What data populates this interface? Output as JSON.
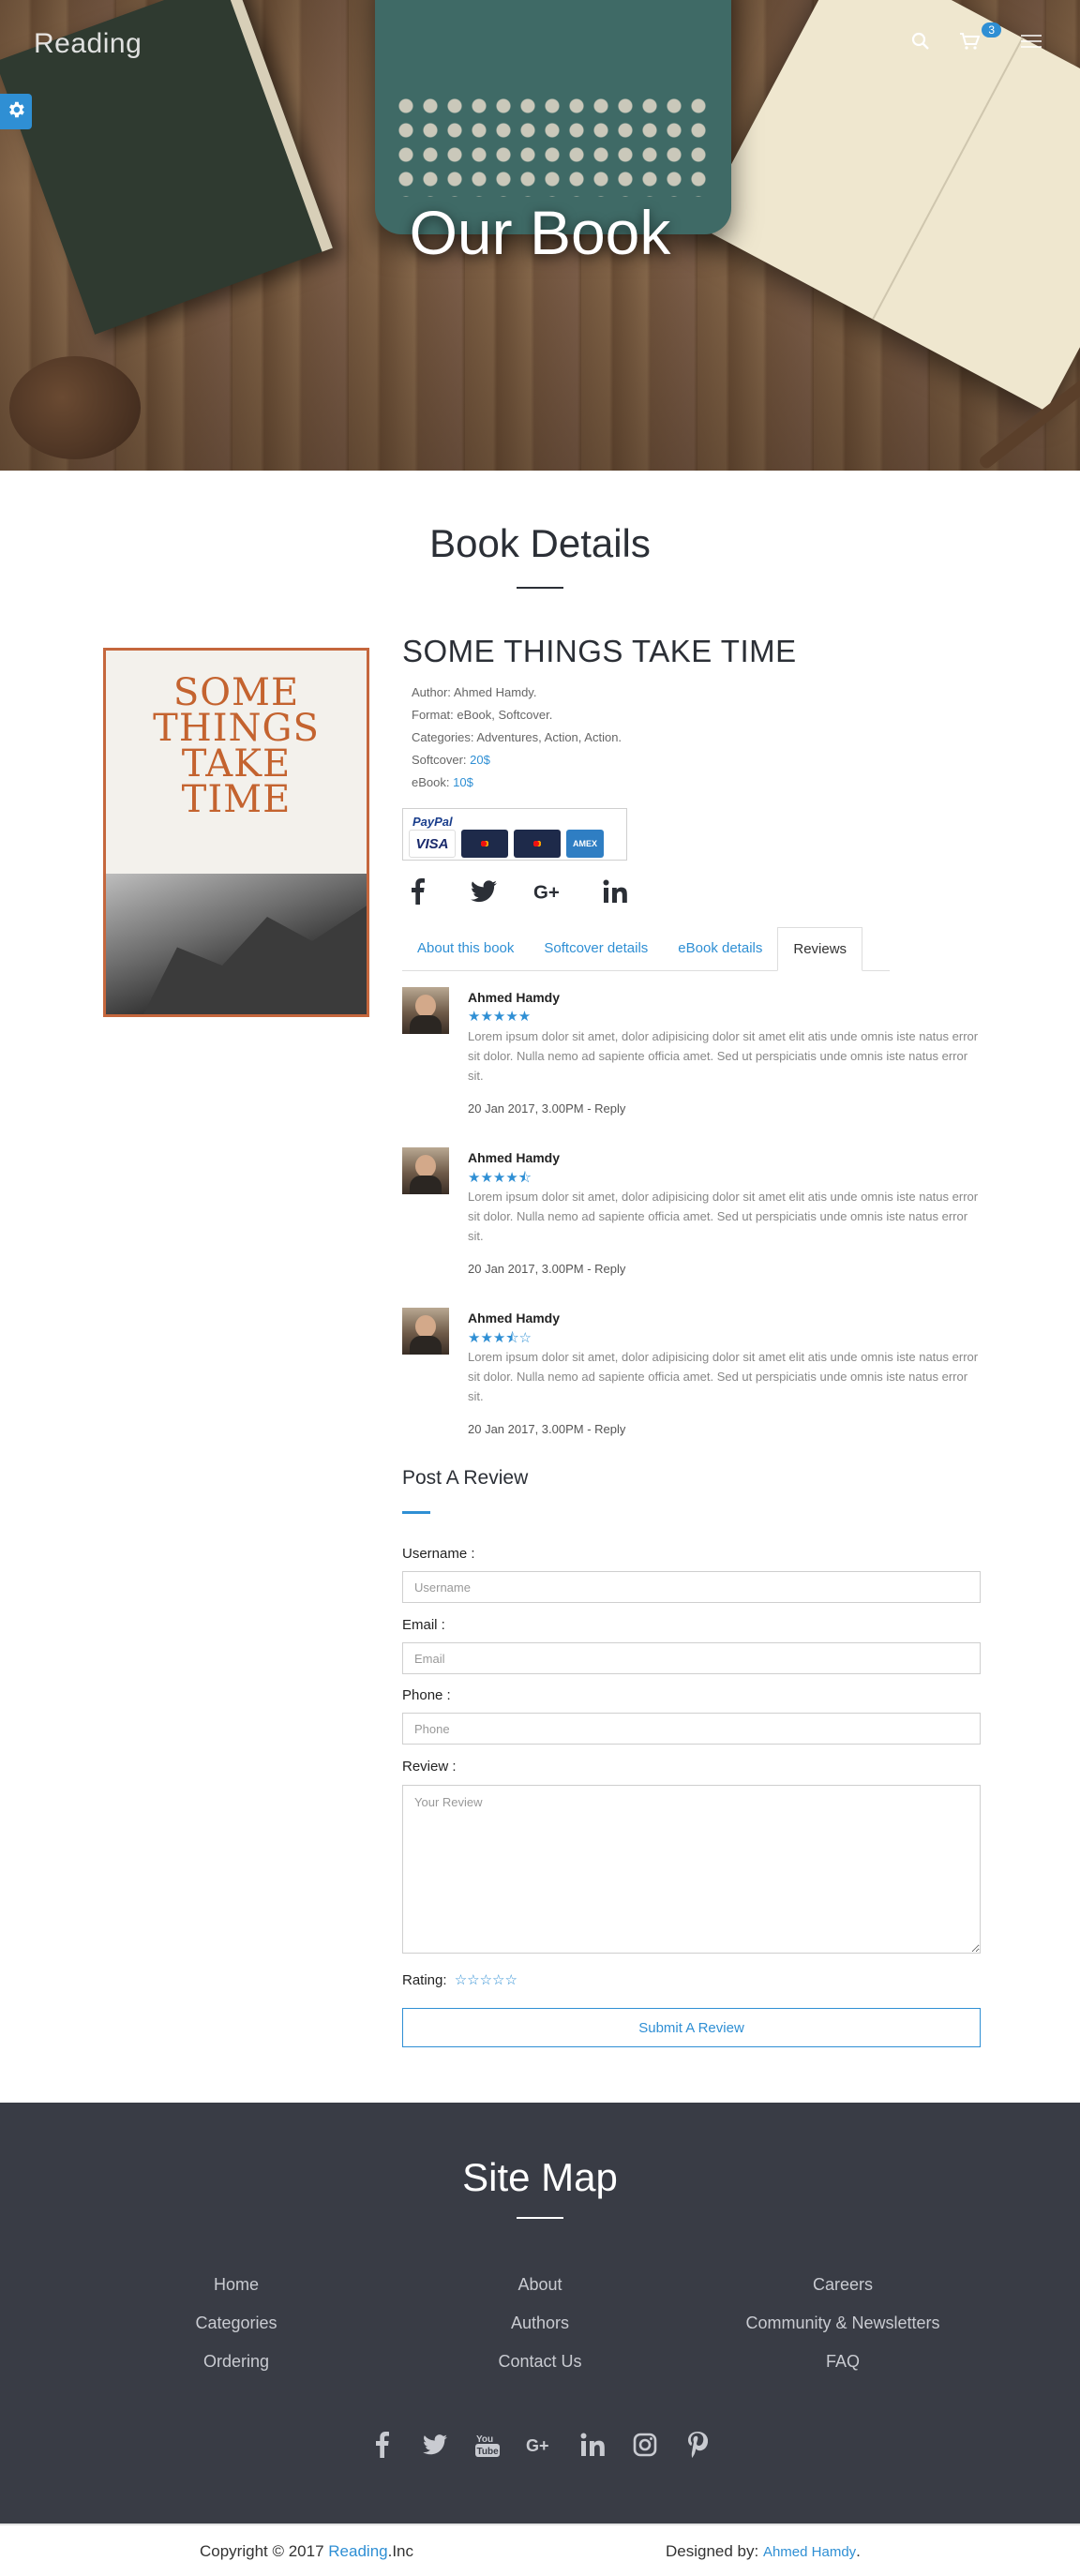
{
  "header": {
    "brand": "Reading",
    "cart_count": "3",
    "hero_title": "Our Book"
  },
  "details": {
    "section_title": "Book Details",
    "book_title": "SOME THINGS TAKE TIME",
    "cover_title_lines": [
      "SOME",
      "THINGS",
      "TAKE",
      "TIME"
    ],
    "meta": [
      {
        "label": "Author:",
        "value": "Ahmed Hamdy."
      },
      {
        "label": "Format:",
        "value": "eBook, Softcover."
      },
      {
        "label": "Categories:",
        "value": "Adventures, Action, Action."
      },
      {
        "label": "Softcover:",
        "value": "20$"
      },
      {
        "label": "eBook:",
        "value": "10$"
      }
    ],
    "payment": {
      "paypal": "PayPal",
      "cards": [
        "VISA",
        "MasterCard",
        "Maestro",
        "AMERICAN EXPRESS"
      ]
    },
    "share_icons": [
      "facebook-icon",
      "twitter-icon",
      "google-plus-icon",
      "linkedin-icon"
    ],
    "tabs": [
      "About this book",
      "Softcover details",
      "eBook details",
      "Reviews"
    ],
    "active_tab": "Reviews"
  },
  "reviews": [
    {
      "name": "Ahmed Hamdy",
      "rating": 5,
      "stars": "★★★★★",
      "text": "Lorem ipsum dolor sit amet, dolor adipisicing dolor sit amet elit atis unde omnis iste natus error sit dolor. Nulla nemo ad sapiente officia amet. Sed ut perspiciatis unde omnis iste natus error sit.",
      "date": "20 Jan 2017, 3.00PM - Reply"
    },
    {
      "name": "Ahmed Hamdy",
      "rating": 4.5,
      "stars": "★★★★⯪",
      "text": "Lorem ipsum dolor sit amet, dolor adipisicing dolor sit amet elit atis unde omnis iste natus error sit dolor. Nulla nemo ad sapiente officia amet. Sed ut perspiciatis unde omnis iste natus error sit.",
      "date": "20 Jan 2017, 3.00PM - Reply"
    },
    {
      "name": "Ahmed Hamdy",
      "rating": 3.5,
      "stars": "★★★⯪☆",
      "text": "Lorem ipsum dolor sit amet, dolor adipisicing dolor sit amet elit atis unde omnis iste natus error sit dolor. Nulla nemo ad sapiente officia amet. Sed ut perspiciatis unde omnis iste natus error sit.",
      "date": "20 Jan 2017, 3.00PM - Reply"
    }
  ],
  "review_form": {
    "title": "Post A Review",
    "username_label": "Username :",
    "username_placeholder": "Username",
    "email_label": "Email :",
    "email_placeholder": "Email",
    "phone_label": "Phone :",
    "phone_placeholder": "Phone",
    "review_label": "Review :",
    "review_placeholder": "Your Review",
    "rating_label": "Rating:",
    "rating_stars": "☆☆☆☆☆",
    "rating_value": 0,
    "submit_label": "Submit A Review"
  },
  "footer": {
    "title": "Site Map",
    "columns": [
      [
        "Home",
        "Categories",
        "Ordering"
      ],
      [
        "About",
        "Authors",
        "Contact Us"
      ],
      [
        "Careers",
        "Community & Newsletters",
        "FAQ"
      ]
    ],
    "social_icons": [
      "facebook-icon",
      "twitter-icon",
      "youtube-icon",
      "google-plus-icon",
      "linkedin-icon",
      "instagram-icon",
      "pinterest-icon"
    ],
    "copyright_prefix": "Copyright © 2017 ",
    "copyright_brand": "Reading",
    "copyright_suffix": ".Inc",
    "designed_prefix": "Designed by: ",
    "designed_name": "Ahmed Hamdy",
    "designed_suffix": "."
  },
  "colors": {
    "accent": "#2f8fd4",
    "footer_bg": "#393c45",
    "cover_accent": "#c4632f"
  }
}
